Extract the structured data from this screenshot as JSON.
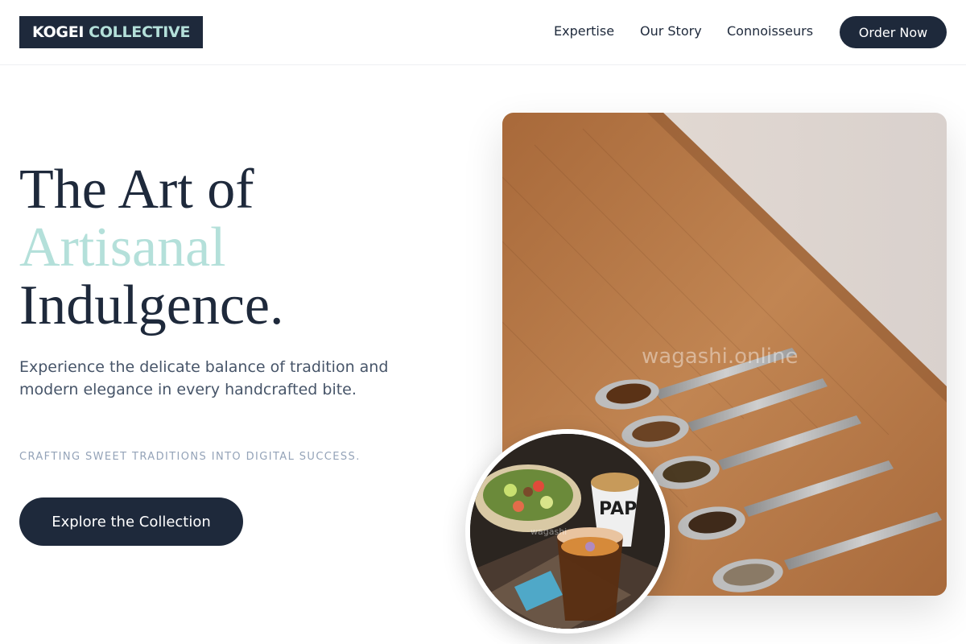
{
  "header": {
    "logo_primary": "KOGEI",
    "logo_accent": "COLLECTIVE",
    "nav": {
      "expertise": "Expertise",
      "story": "Our Story",
      "connoisseurs": "Connoisseurs"
    },
    "order_button": "Order Now"
  },
  "hero": {
    "headline_line1": "The Art of",
    "headline_accent": "Artisanal",
    "headline_line3": "Indulgence.",
    "subtext": "Experience the delicate balance of tradition and modern elegance in every handcrafted bite.",
    "tagline": "CRAFTING SWEET TRADITIONS INTO DIGITAL SUCCESS.",
    "cta": "Explore the Collection"
  },
  "media": {
    "main_watermark": "wagashi.online",
    "inset_watermark": "wagashi",
    "inset_cup_text": "PAP"
  },
  "colors": {
    "navy": "#1e293b",
    "accent_mint": "#b4e0da",
    "muted_text": "#475569",
    "tagline_gray": "#94a3b8"
  }
}
